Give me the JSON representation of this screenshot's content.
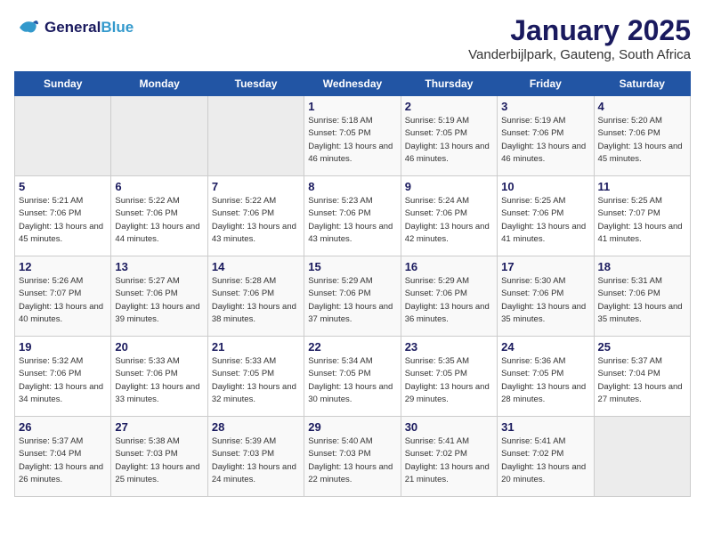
{
  "header": {
    "logo_line1": "General",
    "logo_line2": "Blue",
    "title": "January 2025",
    "subtitle": "Vanderbijlpark, Gauteng, South Africa"
  },
  "weekdays": [
    "Sunday",
    "Monday",
    "Tuesday",
    "Wednesday",
    "Thursday",
    "Friday",
    "Saturday"
  ],
  "weeks": [
    [
      {
        "day": "",
        "sunrise": "",
        "sunset": "",
        "daylight": ""
      },
      {
        "day": "",
        "sunrise": "",
        "sunset": "",
        "daylight": ""
      },
      {
        "day": "",
        "sunrise": "",
        "sunset": "",
        "daylight": ""
      },
      {
        "day": "1",
        "sunrise": "5:18 AM",
        "sunset": "7:05 PM",
        "daylight": "13 hours and 46 minutes."
      },
      {
        "day": "2",
        "sunrise": "5:19 AM",
        "sunset": "7:05 PM",
        "daylight": "13 hours and 46 minutes."
      },
      {
        "day": "3",
        "sunrise": "5:19 AM",
        "sunset": "7:06 PM",
        "daylight": "13 hours and 46 minutes."
      },
      {
        "day": "4",
        "sunrise": "5:20 AM",
        "sunset": "7:06 PM",
        "daylight": "13 hours and 45 minutes."
      }
    ],
    [
      {
        "day": "5",
        "sunrise": "5:21 AM",
        "sunset": "7:06 PM",
        "daylight": "13 hours and 45 minutes."
      },
      {
        "day": "6",
        "sunrise": "5:22 AM",
        "sunset": "7:06 PM",
        "daylight": "13 hours and 44 minutes."
      },
      {
        "day": "7",
        "sunrise": "5:22 AM",
        "sunset": "7:06 PM",
        "daylight": "13 hours and 43 minutes."
      },
      {
        "day": "8",
        "sunrise": "5:23 AM",
        "sunset": "7:06 PM",
        "daylight": "13 hours and 43 minutes."
      },
      {
        "day": "9",
        "sunrise": "5:24 AM",
        "sunset": "7:06 PM",
        "daylight": "13 hours and 42 minutes."
      },
      {
        "day": "10",
        "sunrise": "5:25 AM",
        "sunset": "7:06 PM",
        "daylight": "13 hours and 41 minutes."
      },
      {
        "day": "11",
        "sunrise": "5:25 AM",
        "sunset": "7:07 PM",
        "daylight": "13 hours and 41 minutes."
      }
    ],
    [
      {
        "day": "12",
        "sunrise": "5:26 AM",
        "sunset": "7:07 PM",
        "daylight": "13 hours and 40 minutes."
      },
      {
        "day": "13",
        "sunrise": "5:27 AM",
        "sunset": "7:06 PM",
        "daylight": "13 hours and 39 minutes."
      },
      {
        "day": "14",
        "sunrise": "5:28 AM",
        "sunset": "7:06 PM",
        "daylight": "13 hours and 38 minutes."
      },
      {
        "day": "15",
        "sunrise": "5:29 AM",
        "sunset": "7:06 PM",
        "daylight": "13 hours and 37 minutes."
      },
      {
        "day": "16",
        "sunrise": "5:29 AM",
        "sunset": "7:06 PM",
        "daylight": "13 hours and 36 minutes."
      },
      {
        "day": "17",
        "sunrise": "5:30 AM",
        "sunset": "7:06 PM",
        "daylight": "13 hours and 35 minutes."
      },
      {
        "day": "18",
        "sunrise": "5:31 AM",
        "sunset": "7:06 PM",
        "daylight": "13 hours and 35 minutes."
      }
    ],
    [
      {
        "day": "19",
        "sunrise": "5:32 AM",
        "sunset": "7:06 PM",
        "daylight": "13 hours and 34 minutes."
      },
      {
        "day": "20",
        "sunrise": "5:33 AM",
        "sunset": "7:06 PM",
        "daylight": "13 hours and 33 minutes."
      },
      {
        "day": "21",
        "sunrise": "5:33 AM",
        "sunset": "7:05 PM",
        "daylight": "13 hours and 32 minutes."
      },
      {
        "day": "22",
        "sunrise": "5:34 AM",
        "sunset": "7:05 PM",
        "daylight": "13 hours and 30 minutes."
      },
      {
        "day": "23",
        "sunrise": "5:35 AM",
        "sunset": "7:05 PM",
        "daylight": "13 hours and 29 minutes."
      },
      {
        "day": "24",
        "sunrise": "5:36 AM",
        "sunset": "7:05 PM",
        "daylight": "13 hours and 28 minutes."
      },
      {
        "day": "25",
        "sunrise": "5:37 AM",
        "sunset": "7:04 PM",
        "daylight": "13 hours and 27 minutes."
      }
    ],
    [
      {
        "day": "26",
        "sunrise": "5:37 AM",
        "sunset": "7:04 PM",
        "daylight": "13 hours and 26 minutes."
      },
      {
        "day": "27",
        "sunrise": "5:38 AM",
        "sunset": "7:03 PM",
        "daylight": "13 hours and 25 minutes."
      },
      {
        "day": "28",
        "sunrise": "5:39 AM",
        "sunset": "7:03 PM",
        "daylight": "13 hours and 24 minutes."
      },
      {
        "day": "29",
        "sunrise": "5:40 AM",
        "sunset": "7:03 PM",
        "daylight": "13 hours and 22 minutes."
      },
      {
        "day": "30",
        "sunrise": "5:41 AM",
        "sunset": "7:02 PM",
        "daylight": "13 hours and 21 minutes."
      },
      {
        "day": "31",
        "sunrise": "5:41 AM",
        "sunset": "7:02 PM",
        "daylight": "13 hours and 20 minutes."
      },
      {
        "day": "",
        "sunrise": "",
        "sunset": "",
        "daylight": ""
      }
    ]
  ],
  "labels": {
    "sunrise": "Sunrise:",
    "sunset": "Sunset:",
    "daylight": "Daylight:"
  }
}
